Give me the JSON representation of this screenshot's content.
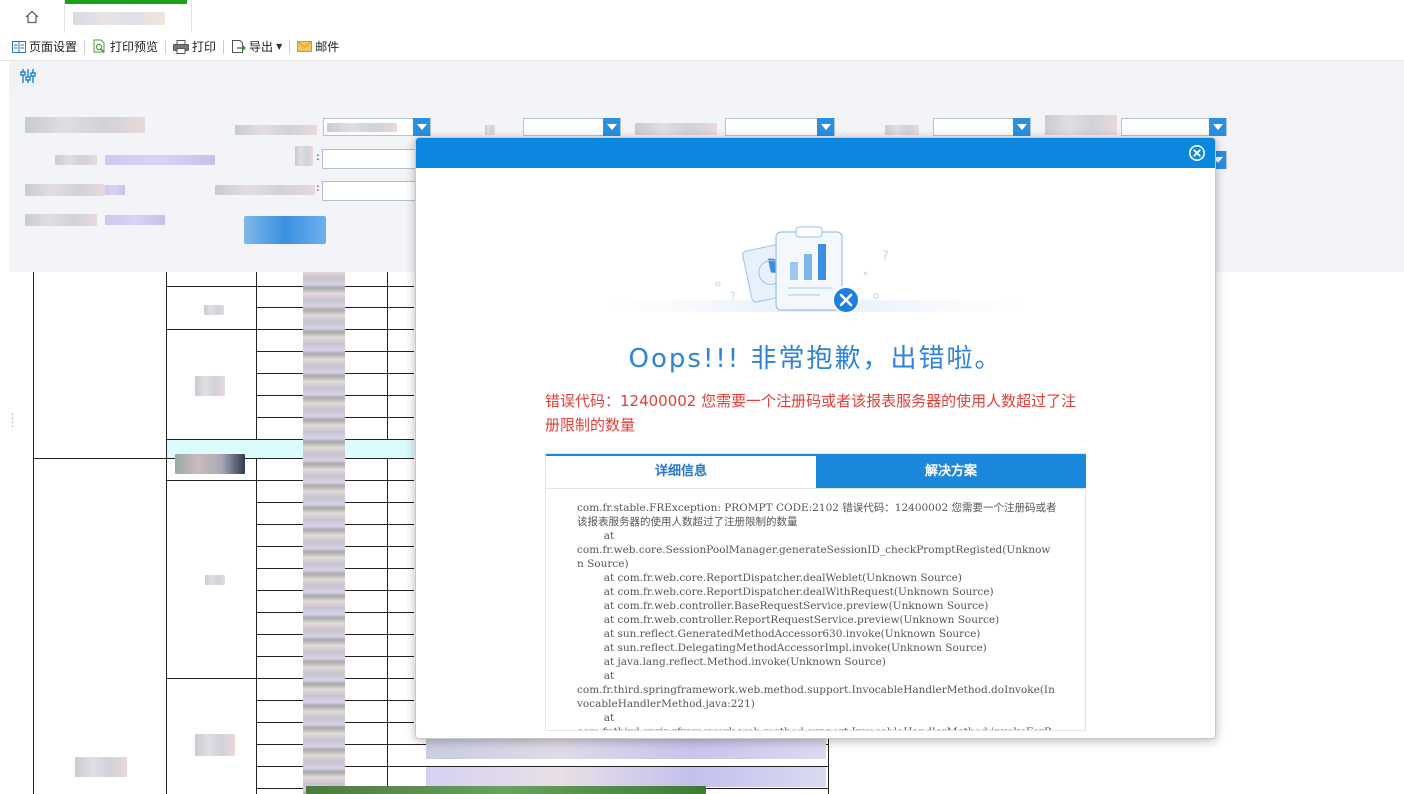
{
  "tabbar": {
    "home_icon": "home-icon",
    "active_tab_accent": "#19a01c"
  },
  "toolbar": {
    "page_setup": "页面设置",
    "print_preview": "打印预览",
    "print": "打印",
    "export": "导出",
    "mail": "邮件"
  },
  "filter": {
    "toggle_icon": "sliders-icon",
    "field_colon": ":",
    "accent": "#2b8fe0"
  },
  "dialog": {
    "header_color": "#0b87e0",
    "close_icon": "close-circle-icon",
    "title": "Oops!!! 非常抱歉，出错啦。",
    "error_message": "错误代码：12400002 您需要一个注册码或者该报表服务器的使用人数超过了注册限制的数量",
    "tabs": [
      {
        "label": "详细信息",
        "active": true
      },
      {
        "label": "解决方案",
        "active": false
      }
    ],
    "detail": "com.fr.stable.FRException: PROMPT CODE:2102 错误代码：12400002 您需要一个注册码或者该报表服务器的使用人数超过了注册限制的数量\n\tat\ncom.fr.web.core.SessionPoolManager.generateSessionID_checkPromptRegisted(Unknown Source)\n\tat com.fr.web.core.ReportDispatcher.dealWeblet(Unknown Source)\n\tat com.fr.web.core.ReportDispatcher.dealWithRequest(Unknown Source)\n\tat com.fr.web.controller.BaseRequestService.preview(Unknown Source)\n\tat com.fr.web.controller.ReportRequestService.preview(Unknown Source)\n\tat sun.reflect.GeneratedMethodAccessor630.invoke(Unknown Source)\n\tat sun.reflect.DelegatingMethodAccessorImpl.invoke(Unknown Source)\n\tat java.lang.reflect.Method.invoke(Unknown Source)\n\tat\ncom.fr.third.springframework.web.method.support.InvocableHandlerMethod.doInvoke(InvocableHandlerMethod.java:221)\n\tat\ncom.fr.third.springframework.web.method.support.InvocableHandlerMethod.invokeForRequest"
  }
}
